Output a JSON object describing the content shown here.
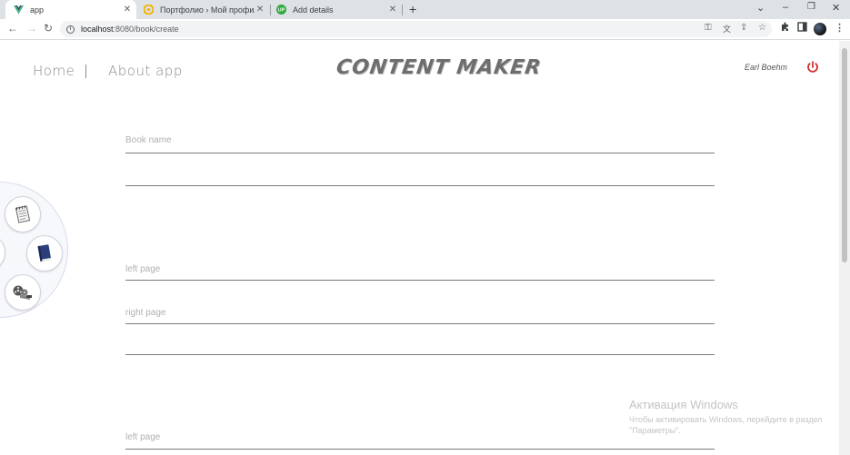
{
  "browser": {
    "tabs": [
      {
        "title": "app",
        "active": true
      },
      {
        "title": "Портфолио › Мой профиль",
        "active": false
      },
      {
        "title": "Add details",
        "active": false
      }
    ],
    "url_host": "localhost",
    "url_path": ":8080/book/create"
  },
  "header": {
    "nav_home": "Home",
    "nav_about": "About app",
    "brand": "CONTENT MAKER",
    "user_name": "Earl Boehm"
  },
  "form": {
    "book_name_placeholder": "Book name",
    "left_page_placeholder": "left page",
    "right_page_placeholder": "right page",
    "left_page_2_placeholder": "left page"
  },
  "radial_menu": {
    "items": [
      "notepad-icon",
      "book-icon",
      "film-reel-icon"
    ]
  },
  "watermark": {
    "title": "Активация Windows",
    "line1": "Чтобы активировать Windows, перейдите в раздел",
    "line2": "\"Параметры\"."
  },
  "colors": {
    "power_icon": "#d32f2f",
    "brand_text": "#6e6e6e",
    "input_underline": "#7a7a7a"
  }
}
